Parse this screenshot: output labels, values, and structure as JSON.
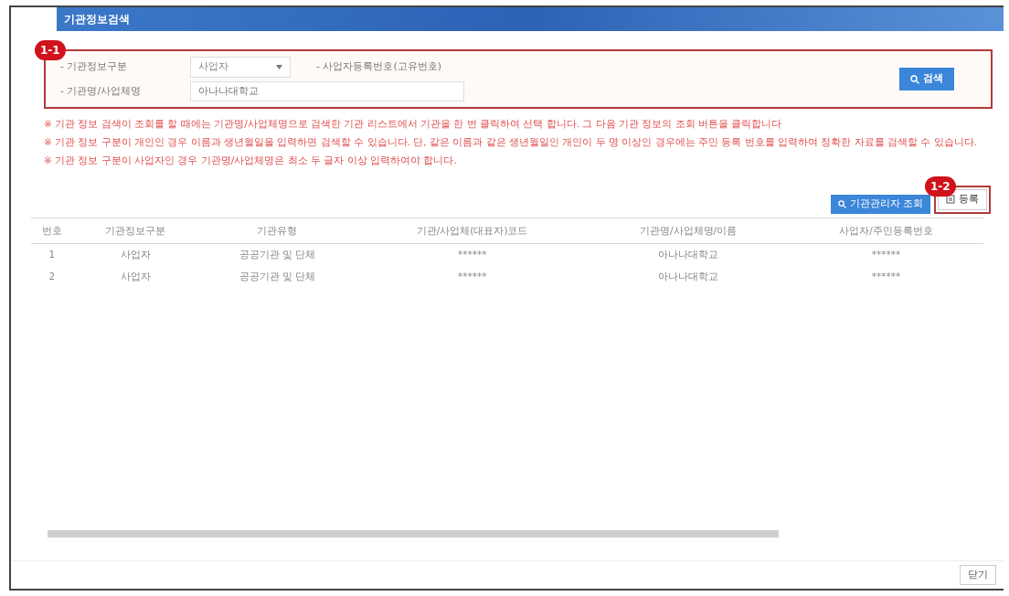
{
  "window": {
    "title": "기관정보검색"
  },
  "search": {
    "badge": "1-1",
    "fields": [
      {
        "label": "- 기관정보구분",
        "kind": "select",
        "value": "사업자"
      },
      {
        "label": "- 사업자등록번호(고유번호)",
        "kind": "label"
      },
      {
        "label": "- 기관명/사업체명",
        "kind": "text",
        "value": "아나나대학교"
      }
    ],
    "button": "검색"
  },
  "notes": [
    "※ 기관 정보 검색이 조회를 할 때에는 기관명/사업체명으로 검색한 기관 리스트에서 기관을 한 번 클릭하여 선택 합니다. 그 다음 기관 정보의 조회 버튼을 클릭합니다",
    "※ 기관 정보 구분이 개인인 경우 이름과 생년월일을 입력하면 검색할 수 있습니다. 단, 같은 이름과 같은 생년월일인 개인이 두 명 이상인 경우에는 주민 등록 번호를 입력하여 정확한 자료를 검색할 수 있습니다.",
    "※ 기관 정보 구분이 사업자인 경우 기관명/사업체명은 최소 두 글자 이상 입력하여야 합니다."
  ],
  "toolbar": {
    "badge": "1-2",
    "buttons": [
      {
        "label": "기관관리자 조회",
        "kind": "primary"
      },
      {
        "label": "등록",
        "kind": "outline"
      }
    ]
  },
  "table": {
    "columns": [
      "번호",
      "기관정보구분",
      "기관유형",
      "기관/사업체(대표자)코드",
      "기관명/사업체명/이름",
      "사업자/주민등록번호"
    ],
    "rows": [
      [
        "1",
        "사업자",
        "공공기관 및 단체",
        "******",
        "아나나대학교",
        "******"
      ],
      [
        "2",
        "사업자",
        "공공기관 및 단체",
        "******",
        "아나나대학교",
        "******"
      ]
    ]
  },
  "close_button": "닫기"
}
